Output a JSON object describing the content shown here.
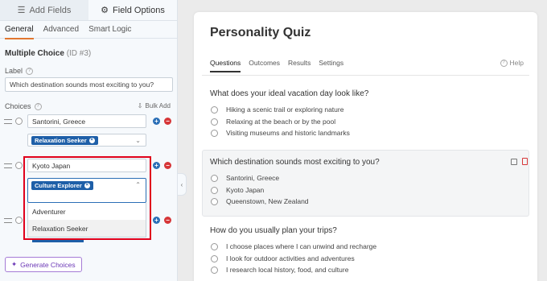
{
  "left_panel": {
    "tabs": [
      {
        "label": "Add Fields",
        "icon": "list-icon"
      },
      {
        "label": "Field Options",
        "icon": "sliders-icon"
      }
    ],
    "sub_tabs": [
      "General",
      "Advanced",
      "Smart Logic"
    ],
    "field_name": "Multiple Choice",
    "field_id": "(ID #3)",
    "label_caption": "Label",
    "label_value": "Which destination sounds most exciting to you?",
    "choices_caption": "Choices",
    "bulk_add": "Bulk Add",
    "choices": [
      {
        "value": "Santorini, Greece",
        "tag": "Relaxation Seeker"
      },
      {
        "value": "Kyoto Japan",
        "tag": "Culture Explorer"
      }
    ],
    "dropdown_options": [
      "Adventurer",
      "Relaxation Seeker"
    ],
    "generate_button": "Generate Choices",
    "accent_color": "#e27730",
    "tag_color": "#1e5fa8",
    "highlight_color": "#e0001b"
  },
  "preview": {
    "title": "Personality Quiz",
    "tabs": [
      "Questions",
      "Outcomes",
      "Results",
      "Settings"
    ],
    "help": "Help",
    "questions": [
      {
        "title": "What does your ideal vacation day look like?",
        "options": [
          "Hiking a scenic trail or exploring nature",
          "Relaxing at the beach or by the pool",
          "Visiting museums and historic landmarks"
        ]
      },
      {
        "title": "Which destination sounds most exciting to you?",
        "options": [
          "Santorini, Greece",
          "Kyoto Japan",
          "Queenstown, New Zealand"
        ]
      },
      {
        "title": "How do you usually plan your trips?",
        "options": [
          "I choose places where I can unwind and recharge",
          "I look for outdoor activities and adventures",
          "I research local history, food, and culture"
        ]
      }
    ]
  }
}
